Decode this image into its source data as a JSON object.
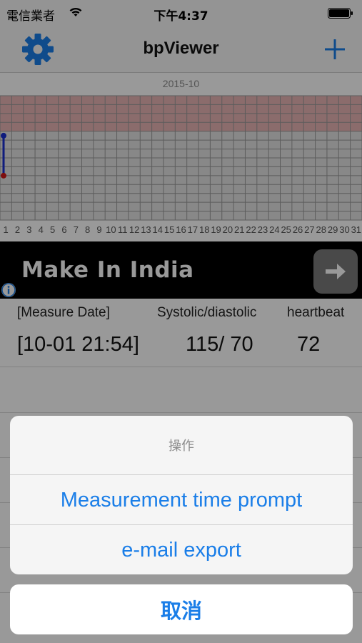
{
  "status_bar": {
    "carrier": "電信業者",
    "time": "下午4:37"
  },
  "nav": {
    "title": "bpViewer",
    "settings_icon": "gear-icon",
    "add_icon": "plus-icon",
    "accent_color": "#1a7ee8"
  },
  "chart": {
    "month_label": "2015-10",
    "day_labels": [
      "1",
      "2",
      "3",
      "4",
      "5",
      "6",
      "7",
      "8",
      "9",
      "10",
      "11",
      "12",
      "13",
      "14",
      "15",
      "16",
      "17",
      "18",
      "19",
      "20",
      "21",
      "22",
      "23",
      "24",
      "25",
      "26",
      "27",
      "28",
      "29",
      "30",
      "31"
    ],
    "high_zone_color": "#e8b4b4",
    "normal_zone_color": "#e3e3e3"
  },
  "chart_data": {
    "type": "line",
    "x": [
      "1"
    ],
    "series": [
      {
        "values": [
          115
        ],
        "color": "#1a2fd0"
      },
      {
        "values": [
          70
        ],
        "color": "#d01a1a"
      }
    ]
  },
  "ad": {
    "text": "Make In India",
    "arrow_icon": "arrow-right-icon",
    "info_icon": "info-icon"
  },
  "table": {
    "headers": {
      "date": "[Measure Date]",
      "bp": "Systolic/diastolic",
      "heartbeat": "heartbeat"
    },
    "rows": [
      {
        "date": "[10-01 21:54]",
        "bp": "115/ 70",
        "heartbeat": "72"
      }
    ]
  },
  "action_sheet": {
    "title": "操作",
    "items": [
      "Measurement time prompt",
      "e-mail export"
    ],
    "cancel": "取消"
  }
}
